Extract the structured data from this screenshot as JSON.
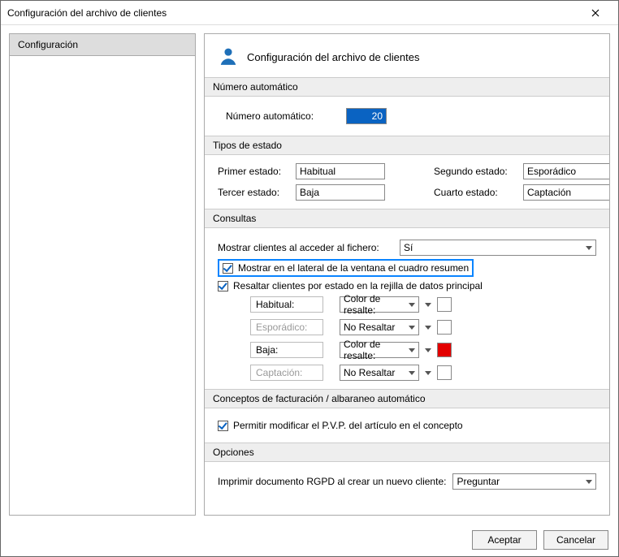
{
  "window": {
    "title": "Configuración del archivo de clientes"
  },
  "sidebar": {
    "tab": "Configuración"
  },
  "header": {
    "title": "Configuración del archivo de clientes"
  },
  "auto_number": {
    "section": "Número automático",
    "label": "Número automático:",
    "value": "20"
  },
  "states": {
    "section": "Tipos de estado",
    "label1": "Primer estado:",
    "val1": "Habitual",
    "label2": "Segundo estado:",
    "val2": "Esporádico",
    "label3": "Tercer estado:",
    "val3": "Baja",
    "label4": "Cuarto estado:",
    "val4": "Captación"
  },
  "queries": {
    "section": "Consultas",
    "show_label": "Mostrar clientes al acceder al fichero:",
    "show_value": "Sí",
    "chk_sidebar": "Mostrar en el lateral de la ventana el cuadro resumen",
    "chk_highlight": "Resaltar clientes por estado en la rejilla de datos principal",
    "rows": {
      "r1_label": "Habitual:",
      "r1_mode": "Color de resalte:",
      "r1_color": "#ffffff",
      "r2_label": "Esporádico:",
      "r2_mode": "No Resaltar",
      "r2_color": "#ffffff",
      "r3_label": "Baja:",
      "r3_mode": "Color de resalte:",
      "r3_color": "#e30000",
      "r4_label": "Captación:",
      "r4_mode": "No Resaltar",
      "r4_color": "#ffffff"
    }
  },
  "billing": {
    "section": "Conceptos de facturación / albaraneo automático",
    "chk": "Permitir modificar el P.V.P. del artículo en el concepto"
  },
  "options": {
    "section": "Opciones",
    "label": "Imprimir documento RGPD al crear un nuevo cliente:",
    "value": "Preguntar"
  },
  "buttons": {
    "ok": "Aceptar",
    "cancel": "Cancelar"
  }
}
